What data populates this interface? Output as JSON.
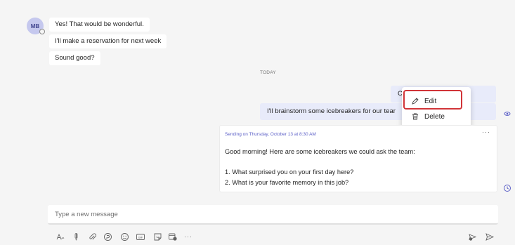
{
  "conversation": {
    "avatar_initials": "MB",
    "received_messages": [
      "Yes! That would be wonderful.",
      "I'll make a reservation for next week",
      "Sound good?"
    ],
    "divider_label": "TODAY",
    "sent_messages": [
      "C",
      "I'll brainstorm some icebreakers for our tear"
    ]
  },
  "context_menu": {
    "items": [
      {
        "label": "Edit",
        "icon": "pencil-icon"
      },
      {
        "label": "Delete",
        "icon": "trash-icon"
      }
    ]
  },
  "scheduled_card": {
    "meta": "Sending on Thursday, October 13 at 8:30 AM",
    "more_label": "···",
    "lines": [
      "Good morning! Here are some icebreakers we could ask the team:",
      "1. What surprised you on your first day here?",
      "2. What is your favorite memory in this job?"
    ]
  },
  "compose": {
    "placeholder": "Type a new message",
    "toolbar_icons": [
      "format-icon",
      "priority-icon",
      "attach-icon",
      "loop-icon",
      "emoji-icon",
      "gif-icon",
      "sticker-icon",
      "schedule-meeting-icon",
      "more-icon"
    ],
    "more_label": "···",
    "right_icons": [
      "send-later-icon",
      "send-icon"
    ]
  },
  "colors": {
    "accent": "#5b5fc7",
    "highlight_border": "#d13438",
    "sent_bubble": "#e8ebfa",
    "background": "#f5f5f5"
  }
}
